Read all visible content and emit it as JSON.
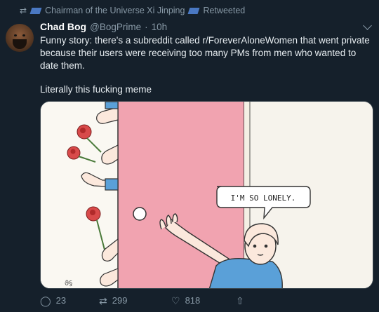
{
  "retweet_bar": {
    "retweeter": "Chairman of the Universe Xi Jinping",
    "label": "Retweeted"
  },
  "tweet": {
    "display_name": "Chad Bog",
    "handle": "@BogPrime",
    "separator": "·",
    "time": "10h",
    "text": "Funny story: there's a subreddit called r/ForeverAloneWomen that went private because their users were receiving too many PMs from men who wanted to date them.",
    "text2": "Literally this fucking meme"
  },
  "meme": {
    "speech_bubble": "I'M SO LONELY."
  },
  "actions": {
    "reply_count": "23",
    "retweet_count": "299",
    "like_count": "818"
  },
  "colors": {
    "background": "#15202b",
    "door": "#f1a3b0",
    "shirt": "#5aa0d8"
  }
}
